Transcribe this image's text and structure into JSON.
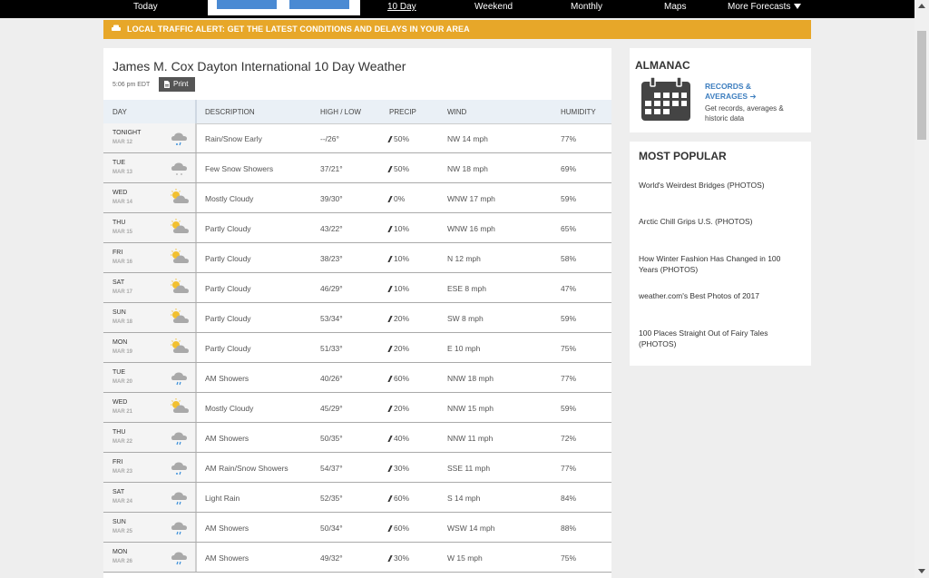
{
  "nav": {
    "items": [
      "Today",
      "10 Day",
      "Weekend",
      "Monthly",
      "Maps",
      "More Forecasts"
    ],
    "active": "10 Day"
  },
  "traffic_alert": "LOCAL TRAFFIC ALERT: GET THE LATEST CONDITIONS AND DELAYS IN YOUR AREA",
  "page": {
    "title": "James M. Cox Dayton International 10 Day Weather",
    "time": "5:06 pm EDT",
    "print_label": "Print"
  },
  "table": {
    "headers": {
      "day": "DAY",
      "description": "DESCRIPTION",
      "highlow": "HIGH / LOW",
      "precip": "PRECIP",
      "wind": "WIND",
      "humidity": "HUMIDITY"
    },
    "rows": [
      {
        "day": "TONIGHT",
        "date": "MAR 12",
        "icon": "rain-snow-icon",
        "desc": "Rain/Snow Early",
        "hilo": "--/26°",
        "precip": "50%",
        "wind": "NW 14 mph",
        "humidity": "77%"
      },
      {
        "day": "TUE",
        "date": "MAR 13",
        "icon": "snow-showers-icon",
        "desc": "Few Snow Showers",
        "hilo": "37/21°",
        "precip": "50%",
        "wind": "NW 18 mph",
        "humidity": "69%"
      },
      {
        "day": "WED",
        "date": "MAR 14",
        "icon": "mostly-cloudy-icon",
        "desc": "Mostly Cloudy",
        "hilo": "39/30°",
        "precip": "0%",
        "wind": "WNW 17 mph",
        "humidity": "59%"
      },
      {
        "day": "THU",
        "date": "MAR 15",
        "icon": "partly-cloudy-icon",
        "desc": "Partly Cloudy",
        "hilo": "43/22°",
        "precip": "10%",
        "wind": "WNW 16 mph",
        "humidity": "65%"
      },
      {
        "day": "FRI",
        "date": "MAR 16",
        "icon": "partly-cloudy-icon",
        "desc": "Partly Cloudy",
        "hilo": "38/23°",
        "precip": "10%",
        "wind": "N 12 mph",
        "humidity": "58%"
      },
      {
        "day": "SAT",
        "date": "MAR 17",
        "icon": "partly-cloudy-icon",
        "desc": "Partly Cloudy",
        "hilo": "46/29°",
        "precip": "10%",
        "wind": "ESE 8 mph",
        "humidity": "47%"
      },
      {
        "day": "SUN",
        "date": "MAR 18",
        "icon": "partly-cloudy-icon",
        "desc": "Partly Cloudy",
        "hilo": "53/34°",
        "precip": "20%",
        "wind": "SW 8 mph",
        "humidity": "59%"
      },
      {
        "day": "MON",
        "date": "MAR 19",
        "icon": "partly-cloudy-icon",
        "desc": "Partly Cloudy",
        "hilo": "51/33°",
        "precip": "20%",
        "wind": "E 10 mph",
        "humidity": "75%"
      },
      {
        "day": "TUE",
        "date": "MAR 20",
        "icon": "showers-icon",
        "desc": "AM Showers",
        "hilo": "40/26°",
        "precip": "60%",
        "wind": "NNW 18 mph",
        "humidity": "77%"
      },
      {
        "day": "WED",
        "date": "MAR 21",
        "icon": "mostly-cloudy-icon",
        "desc": "Mostly Cloudy",
        "hilo": "45/29°",
        "precip": "20%",
        "wind": "NNW 15 mph",
        "humidity": "59%"
      },
      {
        "day": "THU",
        "date": "MAR 22",
        "icon": "showers-icon",
        "desc": "AM Showers",
        "hilo": "50/35°",
        "precip": "40%",
        "wind": "NNW 11 mph",
        "humidity": "72%"
      },
      {
        "day": "FRI",
        "date": "MAR 23",
        "icon": "rain-snow-icon",
        "desc": "AM Rain/Snow Showers",
        "hilo": "54/37°",
        "precip": "30%",
        "wind": "SSE 11 mph",
        "humidity": "77%"
      },
      {
        "day": "SAT",
        "date": "MAR 24",
        "icon": "rain-icon",
        "desc": "Light Rain",
        "hilo": "52/35°",
        "precip": "60%",
        "wind": "S 14 mph",
        "humidity": "84%"
      },
      {
        "day": "SUN",
        "date": "MAR 25",
        "icon": "showers-icon",
        "desc": "AM Showers",
        "hilo": "50/34°",
        "precip": "60%",
        "wind": "WSW 14 mph",
        "humidity": "88%"
      },
      {
        "day": "MON",
        "date": "MAR 26",
        "icon": "showers-icon",
        "desc": "AM Showers",
        "hilo": "49/32°",
        "precip": "30%",
        "wind": "W 15 mph",
        "humidity": "75%"
      }
    ]
  },
  "almanac": {
    "heading": "ALMANAC",
    "link_line1": "RECORDS &",
    "link_line2": "AVERAGES",
    "subtext": "Get records, averages & historic data"
  },
  "popular": {
    "heading": "MOST POPULAR",
    "items": [
      "World's Weirdest Bridges (PHOTOS)",
      "Arctic Chill Grips U.S. (PHOTOS)",
      "How Winter Fashion Has Changed in 100 Years (PHOTOS)",
      "weather.com's Best Photos of 2017",
      "100 Places Straight Out of Fairy Tales (PHOTOS)"
    ]
  },
  "colors": {
    "nav_bg": "#000000",
    "traffic_bg": "#e7a729",
    "link_blue": "#3d7ebf",
    "header_bg": "#eaf0f6"
  }
}
